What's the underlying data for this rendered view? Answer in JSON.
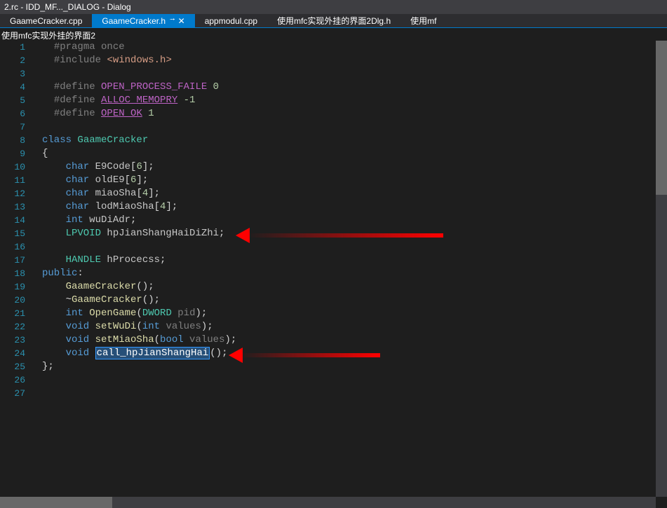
{
  "window_title": "2.rc - IDD_MF..._DIALOG - Dialog",
  "tabs": [
    {
      "label": "GaameCracker.cpp"
    },
    {
      "label": "GaameCracker.h",
      "active": true
    },
    {
      "label": "appmodul.cpp"
    },
    {
      "label": "使用mfc实现外挂的界面2Dlg.h"
    },
    {
      "label": "使用mf"
    }
  ],
  "breadcrumb": "使用mfc实现外挂的界面2",
  "line_numbers": [
    "1",
    "2",
    "3",
    "4",
    "5",
    "6",
    "7",
    "8",
    "9",
    "10",
    "11",
    "12",
    "13",
    "14",
    "15",
    "16",
    "17",
    "18",
    "19",
    "20",
    "21",
    "22",
    "23",
    "24",
    "25",
    "26",
    "27"
  ],
  "code": {
    "l1": {
      "pp": "#pragma",
      "rest": " once"
    },
    "l2": {
      "pp": "#include ",
      "str": "<windows.h>"
    },
    "l4": {
      "pp": "#define ",
      "mac": "OPEN_PROCESS_FAILE",
      "num": " 0"
    },
    "l5": {
      "pp": "#define ",
      "mac": "ALLOC_MEMOPRY",
      "num": " -1"
    },
    "l6": {
      "pp": "#define ",
      "mac": "OPEN_OK",
      "num": " 1"
    },
    "l8": {
      "kw": "class ",
      "type": "GaameCracker"
    },
    "l9": {
      "pl": "{"
    },
    "l10": {
      "kw": "    char",
      "var": " E9Code",
      "pl1": "[",
      "num": "6",
      "pl2": "];"
    },
    "l11": {
      "kw": "    char",
      "var": " oldE9",
      "pl1": "[",
      "num": "6",
      "pl2": "];"
    },
    "l12": {
      "kw": "    char",
      "var": " miaoSha",
      "pl1": "[",
      "num": "4",
      "pl2": "];"
    },
    "l13": {
      "kw": "    char",
      "var": " lodMiaoSha",
      "pl1": "[",
      "num": "4",
      "pl2": "];"
    },
    "l14": {
      "kw": "    int",
      "var": " wuDiAdr",
      "pl": ";"
    },
    "l15": {
      "type": "    LPVOID",
      "var": " hpJianShangHaiDiZhi",
      "pl": ";"
    },
    "l17": {
      "type": "    HANDLE",
      "var": " hProcecss",
      "pl": ";"
    },
    "l18": {
      "kw": "public",
      "pl": ":"
    },
    "l19": {
      "id": "    GaameCracker",
      "pl": "();"
    },
    "l20": {
      "pl1": "    ~",
      "id": "GaameCracker",
      "pl2": "();"
    },
    "l21": {
      "kw": "    int ",
      "id": "OpenGame",
      "pl1": "(",
      "type": "DWORD",
      "par": " pid",
      "pl2": ");"
    },
    "l22": {
      "kw": "    void ",
      "id": "setWuDi",
      "pl1": "(",
      "kw2": "int",
      "par": " values",
      "pl2": ");"
    },
    "l23": {
      "kw": "    void ",
      "id": "setMiaoSha",
      "pl1": "(",
      "kw2": "bool",
      "par": " values",
      "pl2": ");"
    },
    "l24": {
      "kw": "    void ",
      "sel": "call_hpJianShangHai",
      "pl": "();"
    },
    "l25": {
      "pl": "};"
    }
  }
}
